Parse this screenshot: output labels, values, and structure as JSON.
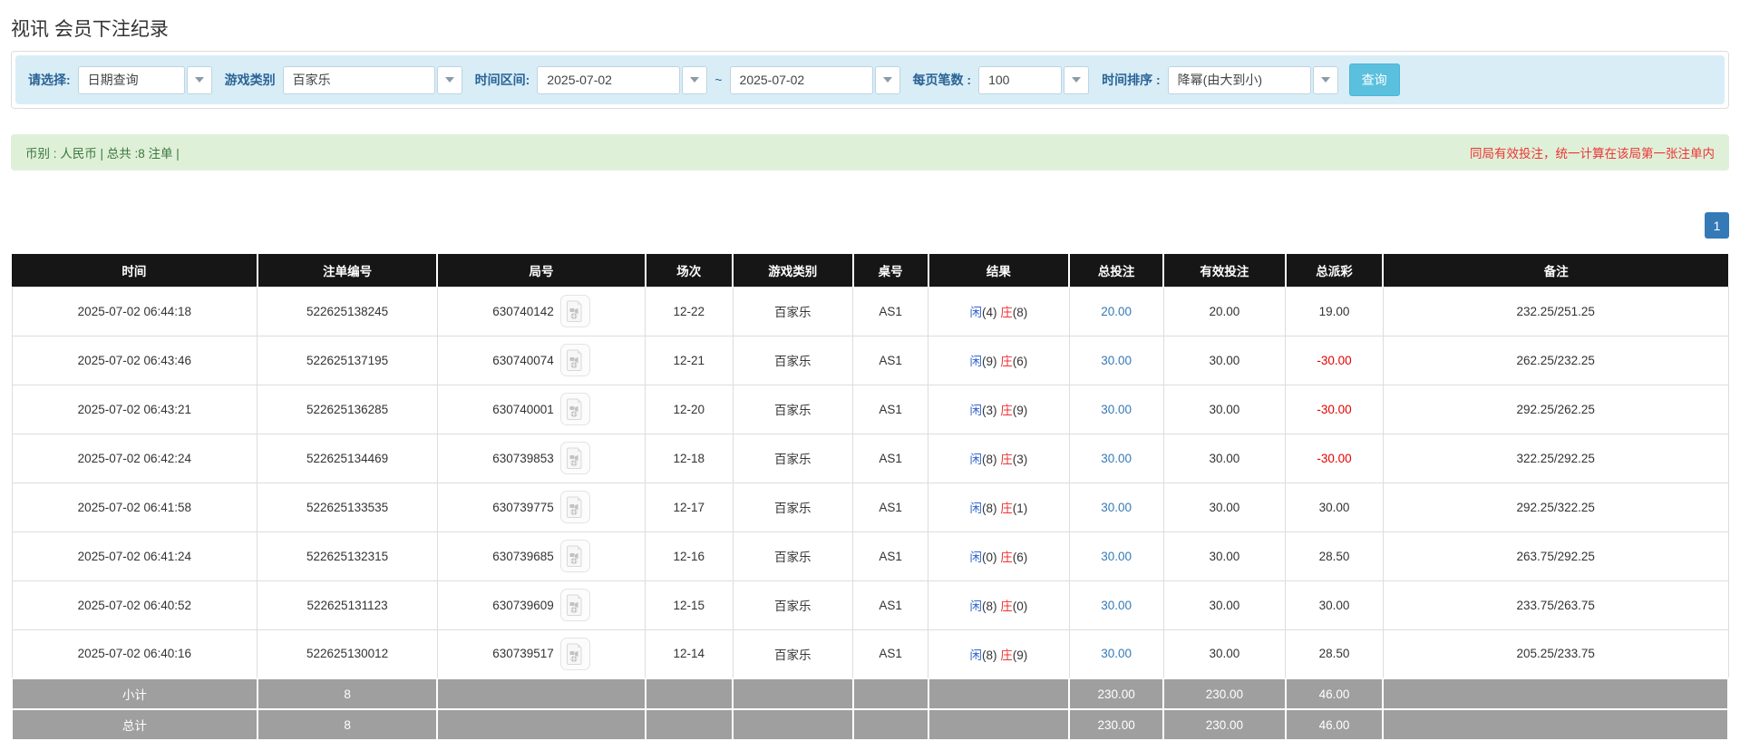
{
  "page": {
    "title": "视讯 会员下注纪录"
  },
  "colors": {
    "filter_bar_bg": "#d9edf7",
    "filter_label": "#2a6496",
    "query_button": "#5bc0de",
    "summary_bg": "#dff0d8",
    "summary_text": "#3c763d",
    "notice_red": "#e63333",
    "header_bg": "#161616",
    "footer_bg": "#9f9f9f",
    "player_blue": "#3366cc",
    "banker_red": "#e63333",
    "link_blue": "#337ab7",
    "negative_red": "#e60000",
    "pager_active": "#337ab7"
  },
  "filters": {
    "select_label": "请选择:",
    "select_value": "日期查询",
    "game_type_label": "游戏类别",
    "game_type_value": "百家乐",
    "date_range_label": "时间区间:",
    "date_from": "2025-07-02",
    "date_separator": "~",
    "date_to": "2025-07-02",
    "page_size_label": "每页笔数 :",
    "page_size_value": "100",
    "sort_label": "时间排序 :",
    "sort_value": "降幂(由大到小)",
    "query_button_label": "查询"
  },
  "summary": {
    "left_text": "币别 : 人民币 | 总共 :8 注单 |",
    "right_notice": "同局有效投注，统一计算在该局第一张注单内"
  },
  "pagination": {
    "current_page": "1"
  },
  "table": {
    "headers": {
      "time": "时间",
      "bet_id": "注单编号",
      "round_id": "局号",
      "session": "场次",
      "game_type": "游戏类别",
      "table_no": "桌号",
      "result": "结果",
      "total_bet": "总投注",
      "valid_bet": "有效投注",
      "payout": "总派彩",
      "remark": "备注"
    },
    "rows": [
      {
        "time": "2025-07-02 06:44:18",
        "bet_id": "522625138245",
        "round_id": "630740142",
        "session": "12-22",
        "game_type": "百家乐",
        "table_no": "AS1",
        "player": "闲",
        "player_pts": "(4)",
        "banker": "庄",
        "banker_pts": "(8)",
        "total_bet": "20.00",
        "valid_bet": "20.00",
        "payout": "19.00",
        "remark": "232.25/251.25"
      },
      {
        "time": "2025-07-02 06:43:46",
        "bet_id": "522625137195",
        "round_id": "630740074",
        "session": "12-21",
        "game_type": "百家乐",
        "table_no": "AS1",
        "player": "闲",
        "player_pts": "(9)",
        "banker": "庄",
        "banker_pts": "(6)",
        "total_bet": "30.00",
        "valid_bet": "30.00",
        "payout": "-30.00",
        "remark": "262.25/232.25"
      },
      {
        "time": "2025-07-02 06:43:21",
        "bet_id": "522625136285",
        "round_id": "630740001",
        "session": "12-20",
        "game_type": "百家乐",
        "table_no": "AS1",
        "player": "闲",
        "player_pts": "(3)",
        "banker": "庄",
        "banker_pts": "(9)",
        "total_bet": "30.00",
        "valid_bet": "30.00",
        "payout": "-30.00",
        "remark": "292.25/262.25"
      },
      {
        "time": "2025-07-02 06:42:24",
        "bet_id": "522625134469",
        "round_id": "630739853",
        "session": "12-18",
        "game_type": "百家乐",
        "table_no": "AS1",
        "player": "闲",
        "player_pts": "(8)",
        "banker": "庄",
        "banker_pts": "(3)",
        "total_bet": "30.00",
        "valid_bet": "30.00",
        "payout": "-30.00",
        "remark": "322.25/292.25"
      },
      {
        "time": "2025-07-02 06:41:58",
        "bet_id": "522625133535",
        "round_id": "630739775",
        "session": "12-17",
        "game_type": "百家乐",
        "table_no": "AS1",
        "player": "闲",
        "player_pts": "(8)",
        "banker": "庄",
        "banker_pts": "(1)",
        "total_bet": "30.00",
        "valid_bet": "30.00",
        "payout": "30.00",
        "remark": "292.25/322.25"
      },
      {
        "time": "2025-07-02 06:41:24",
        "bet_id": "522625132315",
        "round_id": "630739685",
        "session": "12-16",
        "game_type": "百家乐",
        "table_no": "AS1",
        "player": "闲",
        "player_pts": "(0)",
        "banker": "庄",
        "banker_pts": "(6)",
        "total_bet": "30.00",
        "valid_bet": "30.00",
        "payout": "28.50",
        "remark": "263.75/292.25"
      },
      {
        "time": "2025-07-02 06:40:52",
        "bet_id": "522625131123",
        "round_id": "630739609",
        "session": "12-15",
        "game_type": "百家乐",
        "table_no": "AS1",
        "player": "闲",
        "player_pts": "(8)",
        "banker": "庄",
        "banker_pts": "(0)",
        "total_bet": "30.00",
        "valid_bet": "30.00",
        "payout": "30.00",
        "remark": "233.75/263.75"
      },
      {
        "time": "2025-07-02 06:40:16",
        "bet_id": "522625130012",
        "round_id": "630739517",
        "session": "12-14",
        "game_type": "百家乐",
        "table_no": "AS1",
        "player": "闲",
        "player_pts": "(8)",
        "banker": "庄",
        "banker_pts": "(9)",
        "total_bet": "30.00",
        "valid_bet": "30.00",
        "payout": "28.50",
        "remark": "205.25/233.75"
      }
    ],
    "subtotal": {
      "label": "小计",
      "count": "8",
      "total_bet": "230.00",
      "valid_bet": "230.00",
      "payout": "46.00"
    },
    "total": {
      "label": "总计",
      "count": "8",
      "total_bet": "230.00",
      "valid_bet": "230.00",
      "payout": "46.00"
    }
  }
}
